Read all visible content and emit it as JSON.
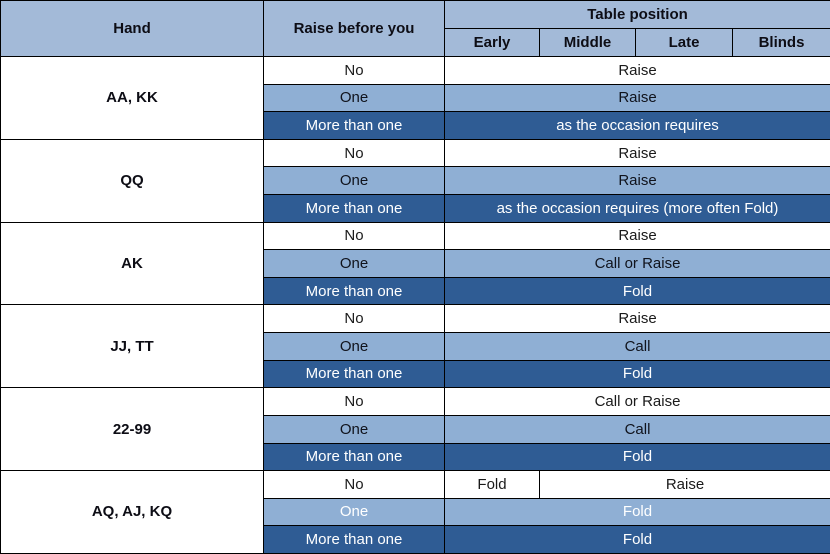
{
  "table": {
    "headers": {
      "hand": "Hand",
      "raise_before_you": "Raise before you",
      "table_position": "Table position",
      "positions": [
        "Early",
        "Middle",
        "Late",
        "Blinds"
      ]
    },
    "colors": {
      "header_blue": "#a3bad8",
      "light_blue": "#8fafd4",
      "dark_blue": "#2f5c94",
      "white": "#ffffff",
      "border": "#000000",
      "text_dark": "#0d0d15",
      "text_light": "#ffffff"
    },
    "raise_labels": {
      "none": "No",
      "one": "One",
      "more": "More than one"
    },
    "rows": [
      {
        "hand": "AA, KK",
        "bands": [
          {
            "raise": "No",
            "style": "band-no",
            "cells": [
              {
                "text": "Raise",
                "span": 4
              }
            ]
          },
          {
            "raise": "One",
            "style": "band-one",
            "cells": [
              {
                "text": "Raise",
                "span": 4
              }
            ]
          },
          {
            "raise": "More than one",
            "style": "band-more",
            "cells": [
              {
                "text": "as the occasion requires",
                "span": 4
              }
            ]
          }
        ]
      },
      {
        "hand": "QQ",
        "bands": [
          {
            "raise": "No",
            "style": "band-no",
            "cells": [
              {
                "text": "Raise",
                "span": 4
              }
            ]
          },
          {
            "raise": "One",
            "style": "band-one",
            "cells": [
              {
                "text": "Raise",
                "span": 4
              }
            ]
          },
          {
            "raise": "More than one",
            "style": "band-more",
            "cells": [
              {
                "text": "as the occasion requires  (more often Fold)",
                "span": 4
              }
            ]
          }
        ]
      },
      {
        "hand": "AK",
        "bands": [
          {
            "raise": "No",
            "style": "band-no",
            "cells": [
              {
                "text": "Raise",
                "span": 4
              }
            ]
          },
          {
            "raise": "One",
            "style": "band-one",
            "cells": [
              {
                "text": "Call or Raise",
                "span": 4
              }
            ]
          },
          {
            "raise": "More than one",
            "style": "band-more",
            "cells": [
              {
                "text": "Fold",
                "span": 4
              }
            ]
          }
        ]
      },
      {
        "hand": "JJ, TT",
        "bands": [
          {
            "raise": "No",
            "style": "band-no",
            "cells": [
              {
                "text": "Raise",
                "span": 4
              }
            ]
          },
          {
            "raise": "One",
            "style": "band-one",
            "cells": [
              {
                "text": "Call",
                "span": 4
              }
            ]
          },
          {
            "raise": "More than one",
            "style": "band-more",
            "cells": [
              {
                "text": "Fold",
                "span": 4
              }
            ]
          }
        ]
      },
      {
        "hand": "22-99",
        "bands": [
          {
            "raise": "No",
            "style": "band-no",
            "cells": [
              {
                "text": "Call or Raise",
                "span": 4
              }
            ]
          },
          {
            "raise": "One",
            "style": "band-one",
            "cells": [
              {
                "text": "Call",
                "span": 4
              }
            ]
          },
          {
            "raise": "More than one",
            "style": "band-more",
            "cells": [
              {
                "text": "Fold",
                "span": 4
              }
            ]
          }
        ]
      },
      {
        "hand": "AQ, AJ, KQ",
        "bands": [
          {
            "raise": "No",
            "style": "band-no",
            "cells": [
              {
                "text": "Fold",
                "span": 1
              },
              {
                "text": "Raise",
                "span": 3
              }
            ]
          },
          {
            "raise": "One",
            "style": "band-one ghost",
            "cells": [
              {
                "text": "Fold",
                "span": 4
              }
            ]
          },
          {
            "raise": "More than one",
            "style": "band-more",
            "cells": [
              {
                "text": "Fold",
                "span": 4
              }
            ]
          }
        ]
      }
    ]
  }
}
